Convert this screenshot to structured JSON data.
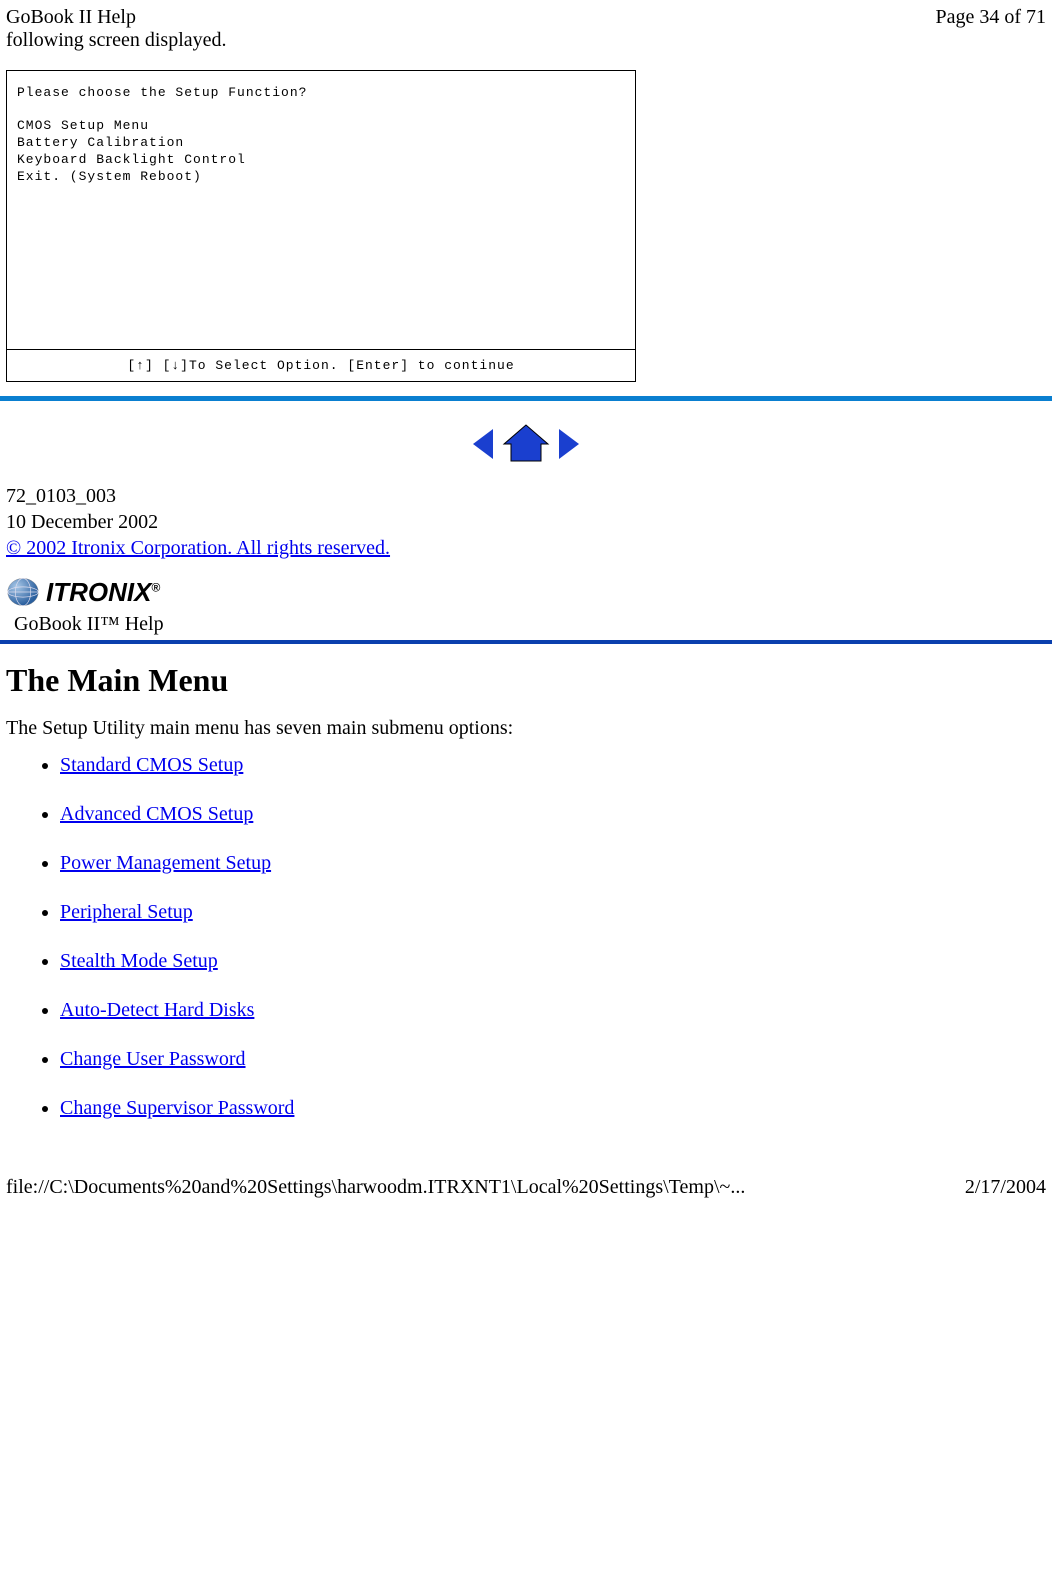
{
  "header": {
    "title": "GoBook II Help",
    "page_indicator": "Page 34 of 71"
  },
  "intro": "following screen displayed.",
  "bios": {
    "prompt": "Please choose the Setup Function?",
    "items": [
      "CMOS Setup Menu",
      "Battery Calibration",
      "Keyboard Backlight Control",
      "Exit. (System Reboot)"
    ],
    "footer": "[↑] [↓]To Select Option.  [Enter] to continue"
  },
  "doc_meta": {
    "part_number": "72_0103_003",
    "date": "10 December 2002",
    "copyright": "© 2002 Itronix Corporation.  All rights reserved."
  },
  "brand": {
    "name": "ITRONIX",
    "reg": "®",
    "help_label": "GoBook II™ Help"
  },
  "section": {
    "heading": "The Main Menu",
    "intro": "The Setup Utility main menu has seven main submenu options:",
    "items": [
      "Standard CMOS Setup",
      "Advanced CMOS Setup",
      "Power Management Setup",
      "Peripheral Setup",
      "Stealth Mode Setup",
      "Auto-Detect Hard Disks",
      "Change User Password",
      "Change Supervisor Password"
    ]
  },
  "footer": {
    "path": "file://C:\\Documents%20and%20Settings\\harwoodm.ITRXNT1\\Local%20Settings\\Temp\\~...",
    "date": "2/17/2004"
  }
}
